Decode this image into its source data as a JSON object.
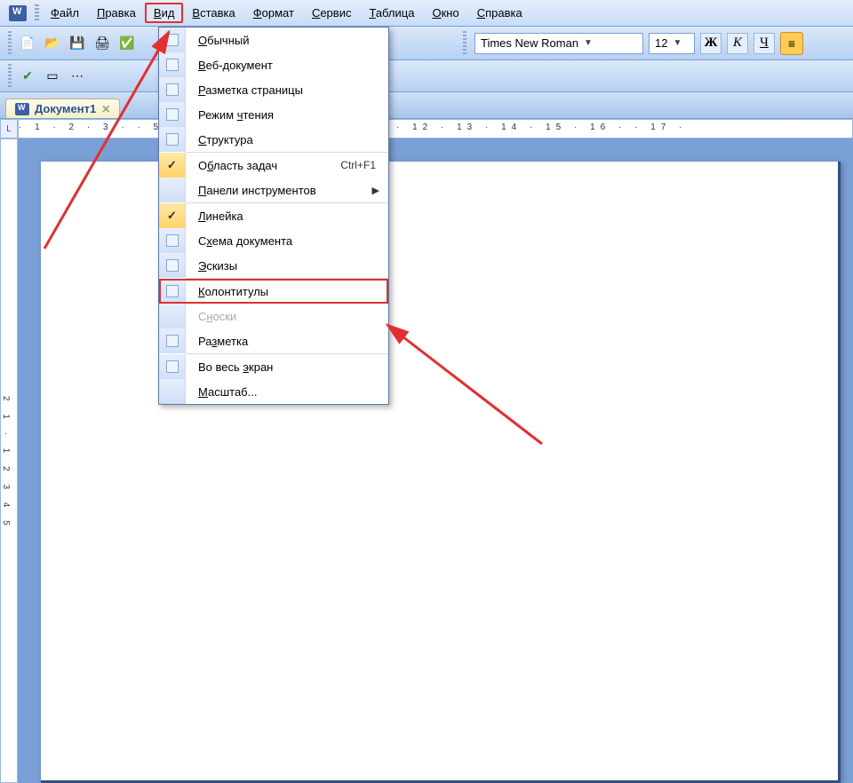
{
  "menubar": {
    "items": [
      "Файл",
      "Правка",
      "Вид",
      "Вставка",
      "Формат",
      "Сервис",
      "Таблица",
      "Окно",
      "Справка"
    ],
    "highlighted_index": 2
  },
  "toolbar": {
    "font_name": "Times New Roman",
    "font_size": "12",
    "bold": "Ж",
    "italic": "К",
    "underline": "Ч"
  },
  "document_tab": {
    "title": "Документ1"
  },
  "ruler": {
    "corner": "L",
    "h_scale": "· 1 · 2 · 3 ·                                                       · 5 · 6 · 7 · 8 · 9 · 10 · 11 · 12 · 13 · 14 · 15 · 16 · · 17 ·",
    "v_scale": "2 1 · 1 2 3 4 5"
  },
  "view_menu": {
    "items": [
      {
        "label": "Обычный",
        "u": "О",
        "icon": "page"
      },
      {
        "label": "Веб-документ",
        "u": "В",
        "icon": "page"
      },
      {
        "label": "Разметка страницы",
        "u": "Р",
        "icon": "page"
      },
      {
        "label": "Режим чтения",
        "u": "ч",
        "icon": "book"
      },
      {
        "label": "Структура",
        "u": "С",
        "icon": "tree"
      },
      {
        "sep": true
      },
      {
        "label": "Область задач",
        "u": "б",
        "checked": true,
        "shortcut": "Ctrl+F1"
      },
      {
        "label": "Панели инструментов",
        "u": "П",
        "submenu": true
      },
      {
        "sep": true
      },
      {
        "label": "Линейка",
        "u": "Л",
        "checked": true
      },
      {
        "label": "Схема документа",
        "u": "х",
        "icon": "map"
      },
      {
        "label": "Эскизы",
        "u": "Э",
        "icon": "thumb"
      },
      {
        "sep": true
      },
      {
        "label": "Колонтитулы",
        "u": "К",
        "icon": "header",
        "highlighted": true
      },
      {
        "label": "Сноски",
        "u": "н",
        "disabled": true
      },
      {
        "label": "Разметка",
        "u": "з",
        "icon": "markup"
      },
      {
        "sep": true
      },
      {
        "label": "Во весь экран",
        "u": "э",
        "icon": "full"
      },
      {
        "label": "Масштаб...",
        "u": "М"
      }
    ]
  }
}
